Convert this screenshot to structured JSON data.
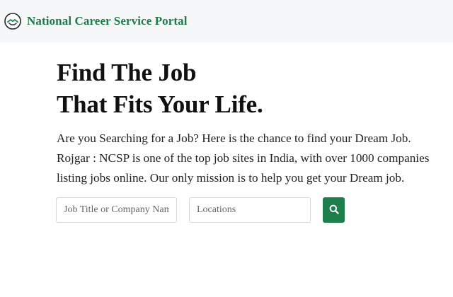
{
  "header": {
    "brand": "National Career Service Portal",
    "logo_icon": "handshake-logo-icon",
    "accent_color": "#1f7a4a"
  },
  "hero": {
    "title_line1": "Find The Job",
    "title_line2": "That Fits Your Life.",
    "description": "Are you Searching for a Job? Here is the chance to find your Dream Job. Rojgar : NCSP is one of the top job sites in India, with over 1000 companies listing jobs online. Our only mission is to help you get your Dream job."
  },
  "search": {
    "job_placeholder": "Job Title or Company Name",
    "job_value": "",
    "location_placeholder": "Locations",
    "location_value": "",
    "button_icon": "search-icon",
    "button_color": "#1e7f4d"
  }
}
